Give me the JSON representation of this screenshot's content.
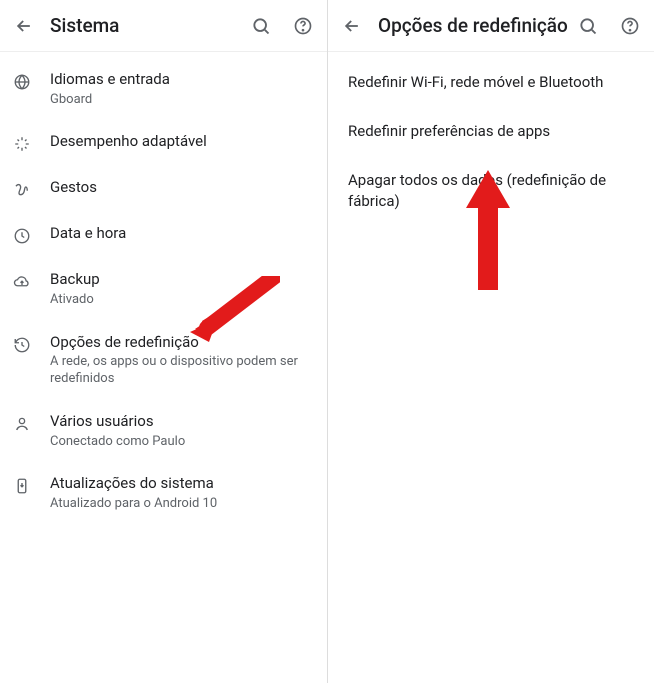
{
  "left": {
    "title": "Sistema",
    "items": [
      {
        "icon": "globe-icon",
        "title": "Idiomas e entrada",
        "sub": "Gboard"
      },
      {
        "icon": "sparkle-icon",
        "title": "Desempenho adaptável",
        "sub": ""
      },
      {
        "icon": "gesture-icon",
        "title": "Gestos",
        "sub": ""
      },
      {
        "icon": "clock-icon",
        "title": "Data e hora",
        "sub": ""
      },
      {
        "icon": "cloud-up-icon",
        "title": "Backup",
        "sub": "Ativado"
      },
      {
        "icon": "history-icon",
        "title": "Opções de redefinição",
        "sub": "A rede, os apps ou o dispositivo podem ser redefinidos"
      },
      {
        "icon": "person-icon",
        "title": "Vários usuários",
        "sub": "Conectado como Paulo"
      },
      {
        "icon": "update-icon",
        "title": "Atualizações do sistema",
        "sub": "Atualizado para o Android 10"
      }
    ]
  },
  "right": {
    "title": "Opções de redefinição",
    "items": [
      "Redefinir Wi-Fi, rede móvel e Bluetooth",
      "Redefinir preferências de apps",
      "Apagar todos os dados (redefinição de fábrica)"
    ]
  }
}
